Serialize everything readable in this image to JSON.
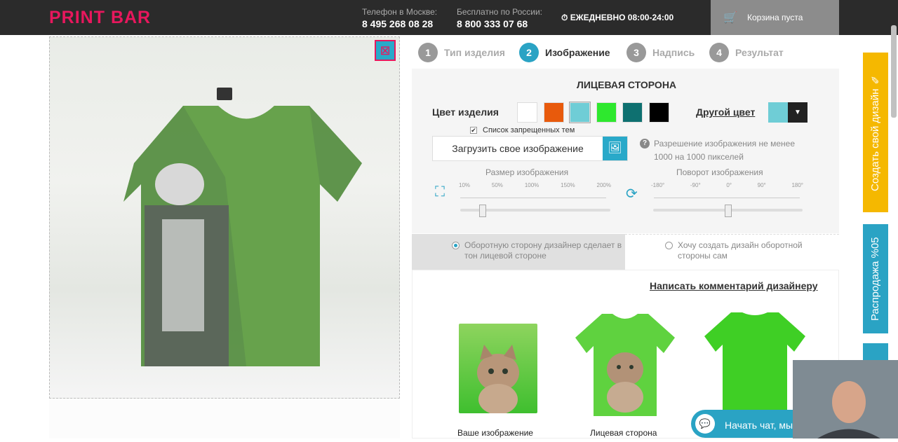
{
  "header": {
    "logo": "PRINT BAR",
    "phone_moscow_label": "Телефон в Москве:",
    "phone_moscow": "8 495 268 08 28",
    "phone_russia_label": "Бесплатно по России:",
    "phone_russia": "8 800 333 07 68",
    "hours": "ЕЖЕДНЕВНО 08:00-24:00",
    "cart": "Корзина пуста"
  },
  "steps": [
    {
      "num": "1",
      "label": "Тип изделия"
    },
    {
      "num": "2",
      "label": "Изображение"
    },
    {
      "num": "3",
      "label": "Надпись"
    },
    {
      "num": "4",
      "label": "Результат"
    }
  ],
  "panel": {
    "side_title": "ЛИЦЕВАЯ СТОРОНА",
    "color_label": "Цвет изделия",
    "colors": [
      "#ffffff",
      "#e85a0c",
      "#6fcdd6",
      "#2ee82e",
      "#0e7070",
      "#000000"
    ],
    "other_color": "Другой цвет",
    "banned_topics": "Список запрещенных тем",
    "upload_label": "Загрузить свое изображение",
    "resolution_note": "Разрешение изображения не менее 1000 на 1000 пикселей",
    "size_label": "Размер изображения",
    "size_ticks": [
      "10%",
      "50%",
      "100%",
      "150%",
      "200%"
    ],
    "size_level": 0.15,
    "rotate_label": "Поворот изображения",
    "rotate_ticks": [
      "-180°",
      "-90°",
      "0°",
      "90°",
      "180°"
    ],
    "rotate_level": 0.5
  },
  "back_side": {
    "option_designer": "Оборотную сторону дизайнер сделает в тон лицевой стороне",
    "option_self": "Хочу создать дизайн оборотной стороны сам"
  },
  "bottom": {
    "comment_link": "Написать комментарий дизайнеру",
    "caption_image": "Ваше изображение",
    "caption_front": "Лицевая сторона"
  },
  "side_tabs": {
    "create": "Создать свой дизайн",
    "sale": "Распродажа",
    "sale_badge": "%05"
  },
  "chat": {
    "label": "Начать чат, мы"
  }
}
